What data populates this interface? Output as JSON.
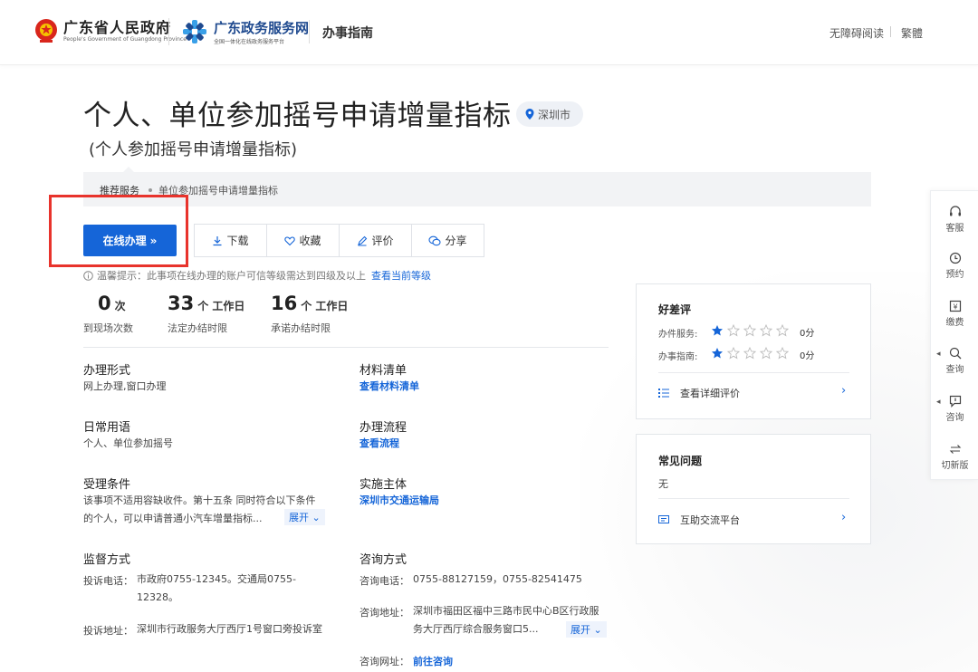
{
  "header": {
    "brand1": "广东省人民政府",
    "brand1_en": "People's Government of Guangdong Province",
    "brand2": "广东政务服务网",
    "brand2_sub": "全国一体化在线政务服务平台",
    "section": "办事指南",
    "accessibility": "无障碍阅读",
    "traditional": "繁體"
  },
  "title": "个人、单位参加摇号申请增量指标",
  "location": "深圳市",
  "subtitle": "(个人参加摇号申请增量指标)",
  "breadcrumb": {
    "recommend": "推荐服务",
    "item": "单位参加摇号申请增量指标"
  },
  "actions": {
    "online": "在线办理",
    "download": "下载",
    "favorite": "收藏",
    "review": "评价",
    "share": "分享"
  },
  "tip": {
    "text": "温馨提示：此事项在线办理的账户可信等级需达到四级及以上",
    "link": "查看当前等级"
  },
  "stats": [
    {
      "num": "0",
      "unit": "次",
      "label": "到现场次数"
    },
    {
      "num": "33",
      "unit": "个 工作日",
      "label": "法定办结时限"
    },
    {
      "num": "16",
      "unit": "个 工作日",
      "label": "承诺办结时限"
    }
  ],
  "fields": {
    "mode_title": "办理形式",
    "mode_val": "网上办理,窗口办理",
    "materials_title": "材料清单",
    "materials_link": "查看材料清单",
    "common_title": "日常用语",
    "common_val": "个人、单位参加摇号",
    "process_title": "办理流程",
    "process_link": "查看流程",
    "cond_title": "受理条件",
    "cond_line1": "该事项不适用容缺收件。第十五条 同时符合以下条件",
    "cond_line2": "的个人，可以申请普通小汽车增量指标...",
    "expand": "展开",
    "entity_title": "实施主体",
    "entity_link": "深圳市交通运输局",
    "supervise_title": "监督方式",
    "complaint_phone_k": "投诉电话：",
    "complaint_phone_v": "市政府0755-12345。交通局0755-12328。",
    "complaint_addr_k": "投诉地址：",
    "complaint_addr_v": "深圳市行政服务大厅西厅1号窗口旁投诉室",
    "consult_title": "咨询方式",
    "consult_phone_k": "咨询电话：",
    "consult_phone_v": "0755-88127159，0755-82541475",
    "consult_addr_k": "咨询地址：",
    "consult_addr_v": "深圳市福田区福中三路市民中心B区行政服务大厅西厅综合服务窗口5...",
    "consult_web_k": "咨询网址：",
    "consult_web_v": "前往咨询"
  },
  "rating": {
    "title": "好差评",
    "service_label": "办件服务:",
    "service_score": "0分",
    "service_stars": 1,
    "guide_label": "办事指南:",
    "guide_score": "0分",
    "guide_stars": 1,
    "detail_link": "查看详细评价"
  },
  "faq": {
    "title": "常见问题",
    "value": "无",
    "platform_link": "互助交流平台"
  },
  "float": {
    "service": "客服",
    "booking": "预约",
    "pay": "缴费",
    "search": "查询",
    "consult": "咨询",
    "switch": "切新版"
  },
  "colors": {
    "primary": "#1565d8",
    "highlight_box": "#e8332c"
  }
}
